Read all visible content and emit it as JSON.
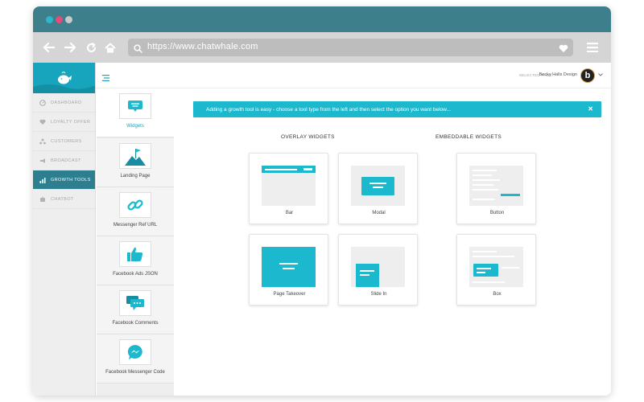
{
  "browser": {
    "url": "https://www.chatwhale.com"
  },
  "sidebar": {
    "items": [
      {
        "label": "DASHBOARD",
        "icon": "dashboard-icon"
      },
      {
        "label": "LOYALTY OFFER",
        "icon": "heart-icon"
      },
      {
        "label": "CUSTOMERS",
        "icon": "customers-icon"
      },
      {
        "label": "BROADCAST",
        "icon": "broadcast-icon"
      },
      {
        "label": "GROWTH TOOLS",
        "icon": "growth-chart-icon",
        "active": true
      },
      {
        "label": "CHATBOT",
        "icon": "chatbot-icon"
      }
    ]
  },
  "header": {
    "selected_page_label": "SELECTED PAGE :",
    "selected_page_name": "Becky Halls Design",
    "avatar_letter": "b"
  },
  "tools": [
    {
      "label": "Widgets",
      "icon": "widget-icon",
      "active": true
    },
    {
      "label": "Landing Page",
      "icon": "landing-page-icon"
    },
    {
      "label": "Messenger Ref URL",
      "icon": "link-icon"
    },
    {
      "label": "Facebook Ads JSON",
      "icon": "thumbs-up-icon"
    },
    {
      "label": "Facebook Comments",
      "icon": "comments-icon"
    },
    {
      "label": "Facebook Messenger Code",
      "icon": "messenger-icon"
    }
  ],
  "banner": {
    "text": "Adding a growth tool is easy - choose a tool type from the left and then select the option you want below...",
    "close": "✕"
  },
  "sections": {
    "overlay_title": "OVERLAY WIDGETS",
    "embeddable_title": "EMBEDDABLE WIDGETS"
  },
  "widgets": {
    "bar": "Bar",
    "modal": "Modal",
    "page_takeover": "Page Takeover",
    "slide_in": "Slide In",
    "button": "Button",
    "box": "Box"
  },
  "colors": {
    "accent": "#1cb8cd",
    "titlebar": "#3e7f8c",
    "active_nav": "#2d7f8f"
  }
}
